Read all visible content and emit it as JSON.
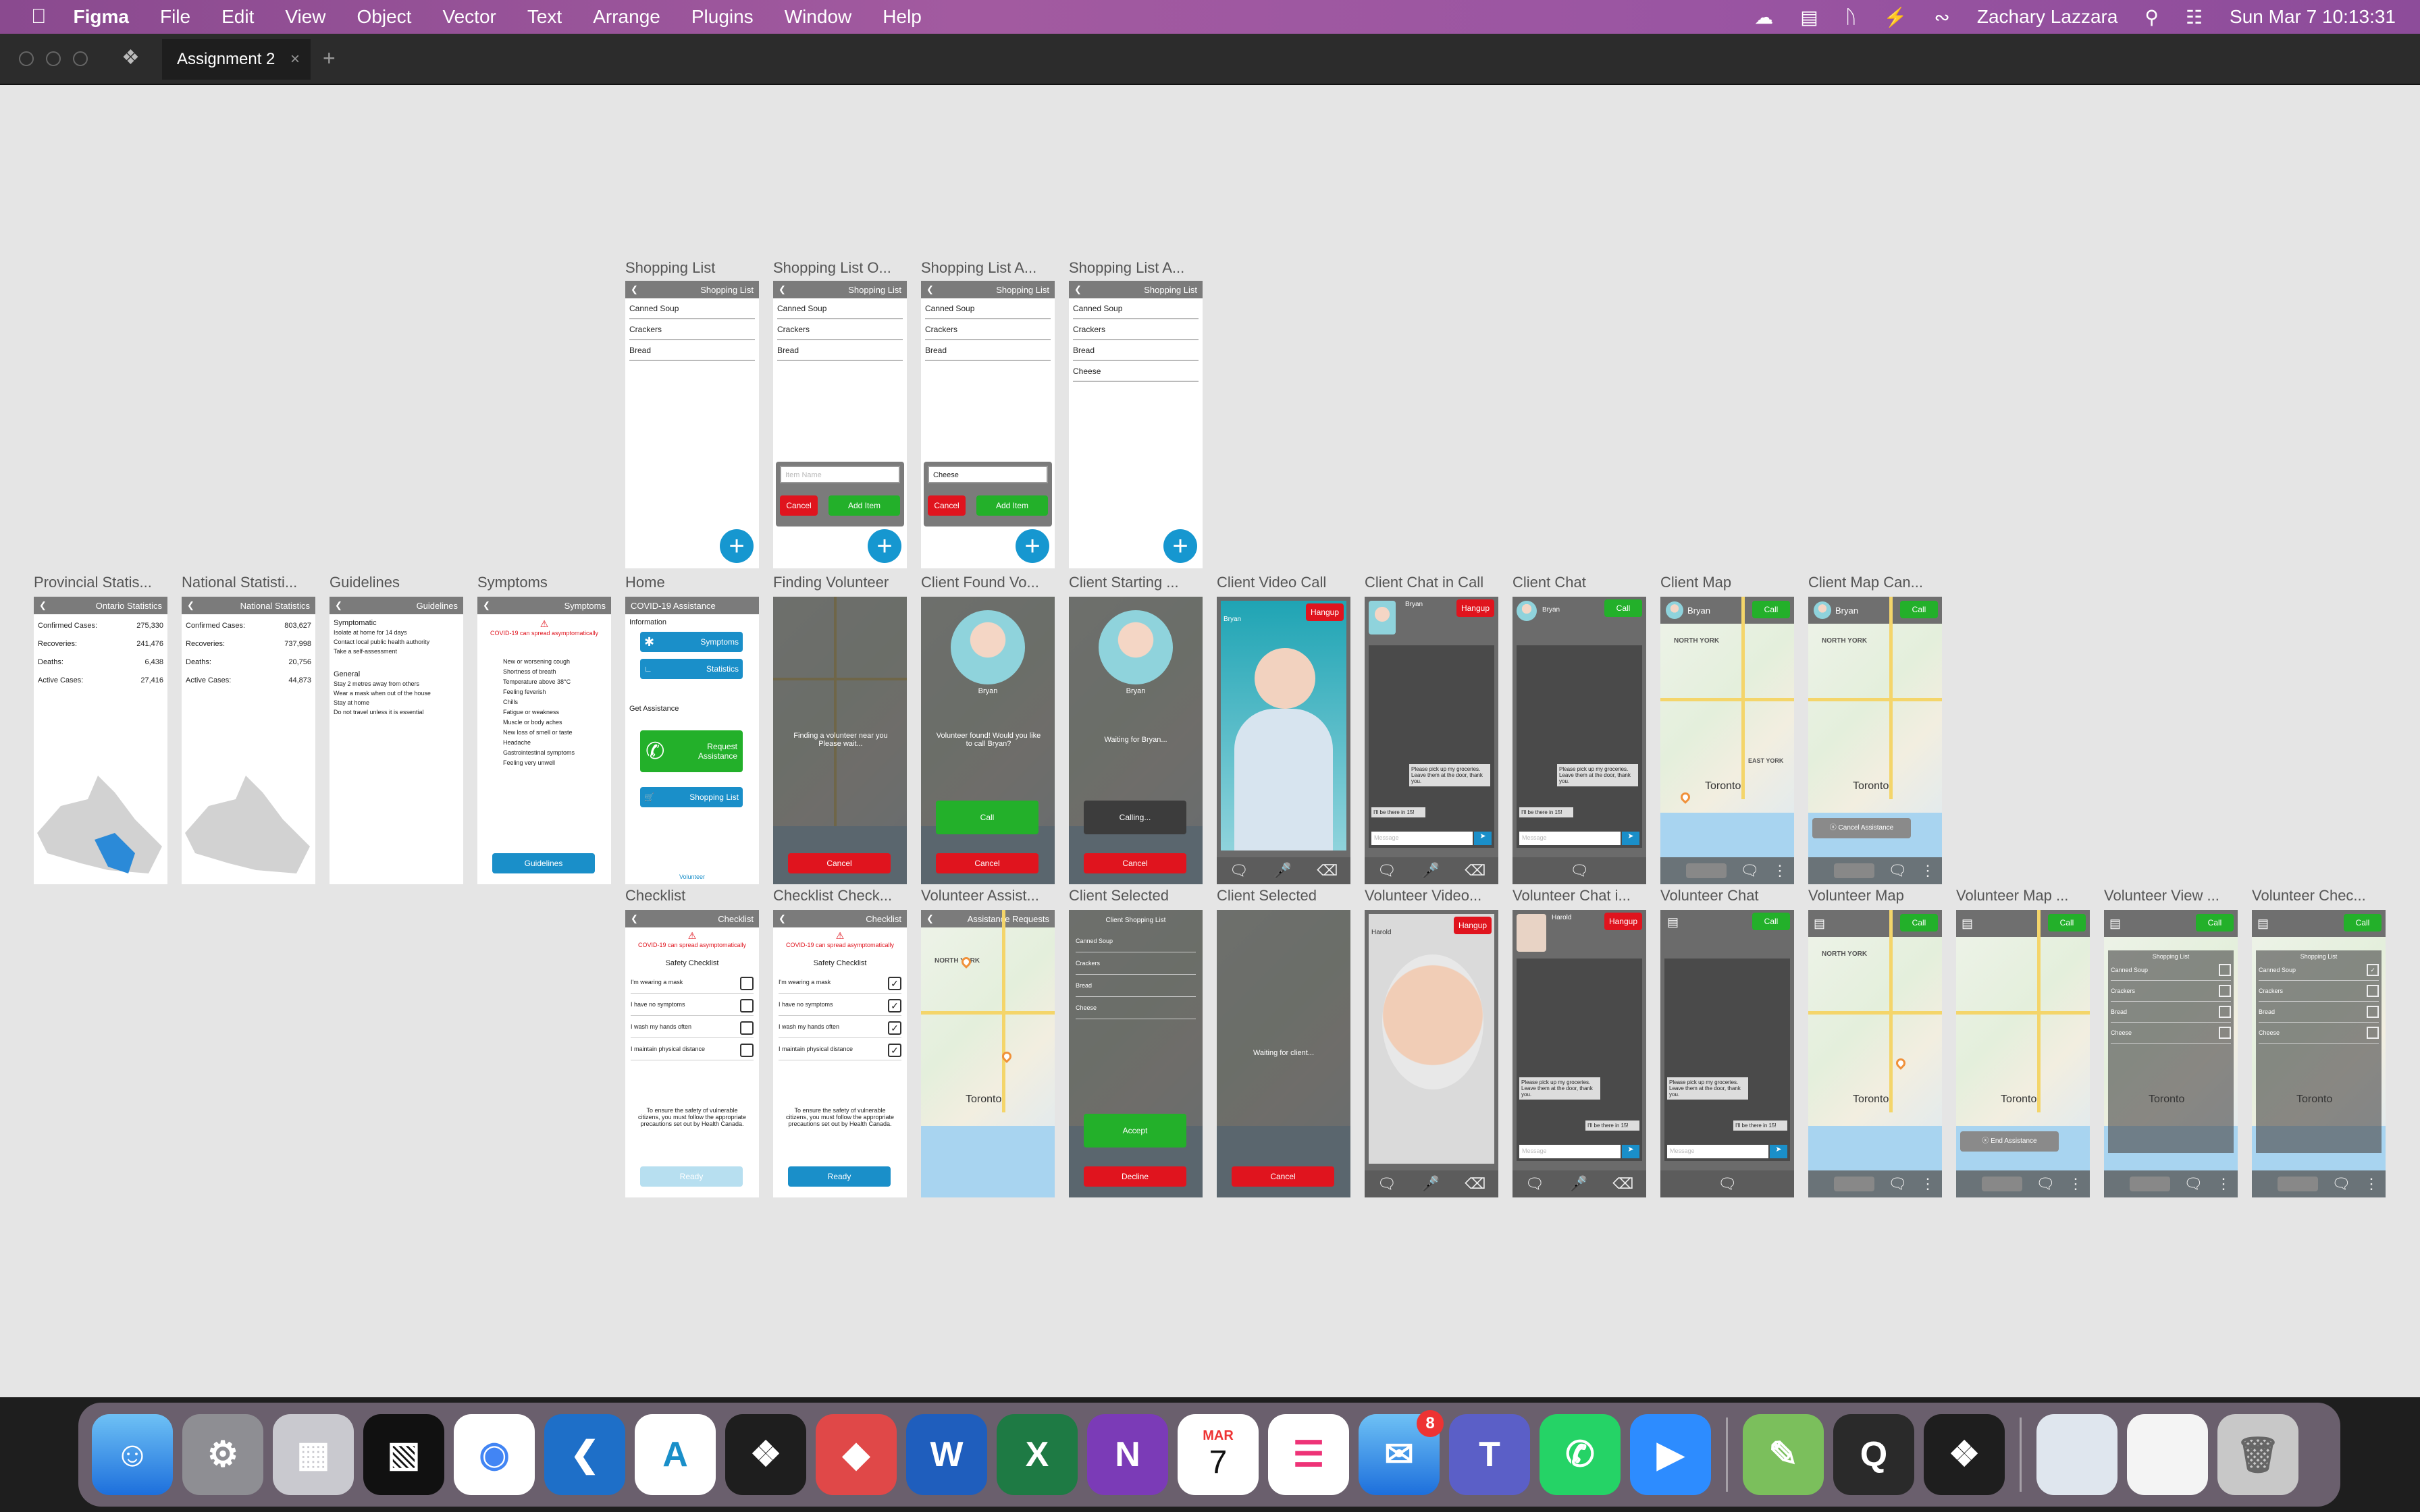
{
  "menubar": {
    "app": "Figma",
    "items": [
      "File",
      "Edit",
      "View",
      "Object",
      "Vector",
      "Text",
      "Arrange",
      "Plugins",
      "Window",
      "Help"
    ],
    "user": "Zachary Lazzara",
    "datetime": "Sun Mar 7  10:13:31"
  },
  "tabs": {
    "active": "Assignment 2"
  },
  "frames": {
    "row1": [
      "Shopping List",
      "Shopping List O...",
      "Shopping List A...",
      "Shopping List A..."
    ],
    "row2": [
      "Provincial Statis...",
      "National Statisti...",
      "Guidelines",
      "Symptoms",
      "Home",
      "Finding Volunteer",
      "Client Found Vo...",
      "Client Starting ...",
      "Client Video Call",
      "Client Chat in Call",
      "Client Chat",
      "Client Map",
      "Client Map Can..."
    ],
    "row3": [
      "Checklist",
      "Checklist Check...",
      "Volunteer Assist...",
      "Client Selected",
      "Client Selected",
      "Volunteer Video...",
      "Volunteer Chat i...",
      "Volunteer Chat",
      "Volunteer Map",
      "Volunteer Map ...",
      "Volunteer View ...",
      "Volunteer Chec..."
    ]
  },
  "shopping": {
    "header": "Shopping List",
    "items": [
      "Canned Soup",
      "Crackers",
      "Bread",
      "Cheese"
    ],
    "placeholder": "Item Name",
    "typed": "Cheese",
    "cancel": "Cancel",
    "add": "Add Item"
  },
  "stats": {
    "ontario": "Ontario Statistics",
    "national": "National Statistics",
    "labels": [
      "Confirmed Cases:",
      "Recoveries:",
      "Deaths:",
      "Active Cases:"
    ],
    "ont_vals": [
      "275,330",
      "241,476",
      "6,438",
      "27,416"
    ],
    "nat_vals": [
      "803,627",
      "737,998",
      "20,756",
      "44,873"
    ]
  },
  "guidelines": {
    "header": "Guidelines",
    "symptomatic": "Symptomatic",
    "s_items": [
      "Isolate at home for 14 days",
      "Contact local public health authority",
      "Take a self-assessment"
    ],
    "general": "General",
    "g_items": [
      "Stay 2 metres away from others",
      "Wear a mask when out of the house",
      "Stay at home",
      "Do not travel unless it is essential"
    ]
  },
  "symptoms": {
    "header": "Symptoms",
    "warn": "COVID-19 can spread asymptomatically",
    "items": [
      "New or worsening cough",
      "Shortness of breath",
      "Temperature above 38°C",
      "Feeling feverish",
      "Chills",
      "Fatigue or weakness",
      "Muscle or body aches",
      "New loss of smell or taste",
      "Headache",
      "Gastrointestinal symptoms",
      "Feeling very unwell"
    ],
    "button": "Guidelines"
  },
  "home": {
    "title": "COVID-19 Assistance",
    "info": "Information",
    "symptoms": "Symptoms",
    "statistics": "Statistics",
    "get": "Get Assistance",
    "request": "Request Assistance",
    "shopping": "Shopping List",
    "volunteer": "Volunteer"
  },
  "finding": {
    "text": "Finding a volunteer near you Please wait...",
    "cancel": "Cancel"
  },
  "found": {
    "name": "Bryan",
    "text": "Volunteer found! Would you like to call Bryan?",
    "call": "Call",
    "cancel": "Cancel",
    "waiting": "Waiting for Bryan...",
    "calling": "Calling..."
  },
  "call": {
    "hangup": "Hangup",
    "call": "Call",
    "name": "Bryan",
    "harold": "Harold",
    "msg": "Please pick up my groceries. Leave them at the door, thank you.",
    "reply": "I'll be there in 15!",
    "placeholder": "Message",
    "toronto": "Toronto",
    "north_york": "NORTH YORK",
    "east_york": "EAST YORK",
    "cancel_assist": "Cancel Assistance",
    "end_assist": "End Assistance"
  },
  "checklist": {
    "header": "Checklist",
    "warn": "COVID-19 can spread asymptomatically",
    "safety": "Safety Checklist",
    "items": [
      "I'm wearing a mask",
      "I have no symptoms",
      "I wash my hands often",
      "I maintain physical distance"
    ],
    "note": "To ensure the safety of vulnerable citizens, you must follow the appropriate precautions set out by Health Canada.",
    "ready": "Ready"
  },
  "volunteer": {
    "requests": "Assistance Requests",
    "client_list": "Client Shopping List",
    "accept": "Accept",
    "decline": "Decline",
    "waiting": "Waiting for client...",
    "cancel": "Cancel",
    "shopping": "Shopping List"
  },
  "dock": {
    "badge": "8",
    "cal_month": "MAR",
    "cal_day": "7"
  }
}
